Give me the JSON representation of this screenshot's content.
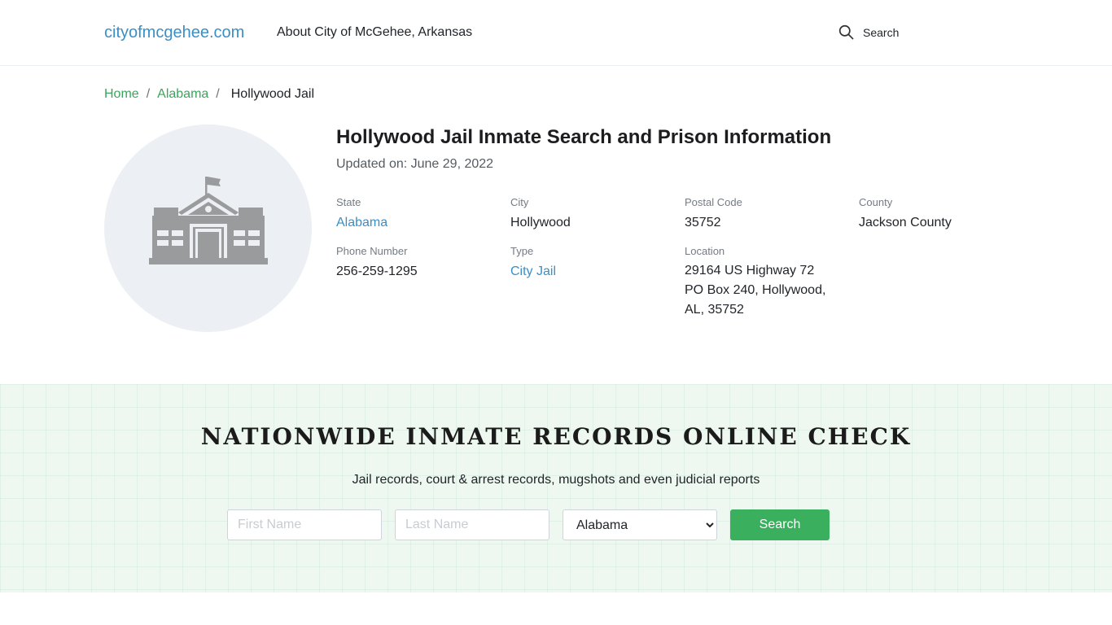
{
  "header": {
    "brand": "cityofmcgehee.com",
    "about_link": "About City of McGehee, Arkansas",
    "search_label": "Search",
    "search_icon": "search-icon"
  },
  "breadcrumb": {
    "items": [
      "Home",
      "Alabama"
    ],
    "current": "Hollywood Jail"
  },
  "facility": {
    "image_icon": "building-icon",
    "title": "Hollywood Jail Inmate Search and Prison Information",
    "updated": "Updated on: June 29, 2022",
    "state_label": "State",
    "state": "Alabama",
    "city_label": "City",
    "city": "Hollywood",
    "postal_label": "Postal Code",
    "postal": "35752",
    "county_label": "County",
    "county": "Jackson County",
    "phone_label": "Phone Number",
    "phone": "256-259-1295",
    "type_label": "Type",
    "type": "City Jail",
    "location_label": "Location",
    "location_lines": [
      "29164 US Highway 72",
      "PO Box 240, Hollywood,",
      "AL, 35752"
    ]
  },
  "nationwide": {
    "heading": "NATIONWIDE INMATE RECORDS ONLINE CHECK",
    "subheading": "Jail records, court & arrest records, mugshots and even judicial reports",
    "first_name_placeholder": "First Name",
    "last_name_placeholder": "Last Name",
    "state_selected": "Alabama",
    "button_label": "Search"
  },
  "colors": {
    "link_blue": "#3a8fc7",
    "breadcrumb_green": "#3aa65b",
    "button_green": "#3ab05e"
  }
}
